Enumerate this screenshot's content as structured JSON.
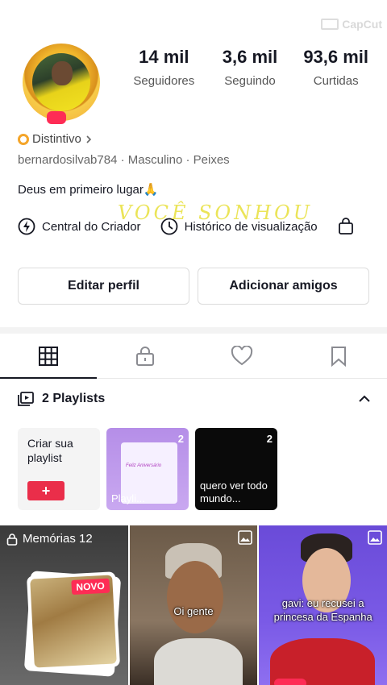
{
  "watermark": "CapCut",
  "profile": {
    "stats": [
      {
        "value": "14 mil",
        "label": "Seguidores"
      },
      {
        "value": "3,6 mil",
        "label": "Seguindo"
      },
      {
        "value": "93,6 mil",
        "label": "Curtidas"
      }
    ],
    "badge": "Distintivo",
    "username": "bernardosilvab784",
    "gender": "Masculino",
    "sign": "Peixes",
    "bio": "Deus em primeiro lugar🙏",
    "links": [
      {
        "label": "Central do Criador",
        "icon": "lightning-icon"
      },
      {
        "label": "Histórico de visualização",
        "icon": "clock-icon"
      }
    ],
    "overlay_text": "VOCÊ SONHOU",
    "buttons": {
      "edit": "Editar perfil",
      "add_friends": "Adicionar amigos"
    }
  },
  "playlists": {
    "header": "2 Playlists",
    "create_label": "Criar sua playlist",
    "create_plus": "+",
    "items": [
      {
        "count": "2",
        "caption": "Playli...",
        "inner_title": "Feliz Aniversário"
      },
      {
        "count": "2",
        "caption": "quero ver todo mundo..."
      }
    ]
  },
  "grid": {
    "memories_label": "Memórias 12",
    "novo": "NOVO",
    "captions": [
      "Oi gente",
      "gavi: eu recusei a princesa da Espanha"
    ]
  }
}
